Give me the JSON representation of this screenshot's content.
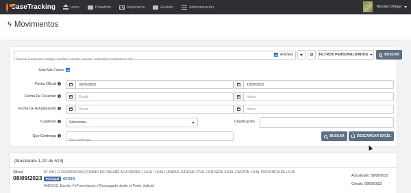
{
  "app": {
    "logo_text": "CaseTracking",
    "nav": [
      {
        "label": "Inicio",
        "icon": "home-icon"
      },
      {
        "label": "Portafolio",
        "icon": "briefcase-icon"
      },
      {
        "label": "Reportería",
        "icon": "chart-icon"
      },
      {
        "label": "Gestión",
        "icon": "folder-icon"
      },
      {
        "label": "Administración",
        "icon": "menu-icon"
      }
    ],
    "user_name": "Nicolas Ortega"
  },
  "page": {
    "title": "Movimientos"
  },
  "search": {
    "placeholder": "Buscar Casos por código, nombre, cliente, asunto, autoridad competente etc...",
    "activada_label": "Activada",
    "filtros_label": "FILTROS PERSONALIZADOS",
    "buscar_label": "BUSCAR"
  },
  "form": {
    "solo_mis_casos_label": "Solo Mis Casos",
    "fecha_oficial_label": "Fecha Oficial",
    "fecha_oficial_from": "30/05/2023",
    "fecha_oficial_to": "10/09/2023",
    "fecha_creacion_label": "Fecha De Creación",
    "fecha_actualizacion_label": "Fecha De Actualización",
    "desde_placeholder": "Desde",
    "hasta_placeholder": "Hasta",
    "cuaderno_label": "Cuaderno",
    "cuaderno_value": "Seleccione...",
    "clasificacion_label": "Clasificación",
    "que_contenga_label": "Que Contenga",
    "que_contenga_placeholder": "Que contenga",
    "buscar_label": "BUSCAR",
    "descargar_label": "DESCARGAR EXCEL"
  },
  "results": {
    "count_text": "(Mostrando 1-20 de 513)",
    "items": [
      {
        "oficial_label": "Oficial:",
        "date": "08/09/2023",
        "main": "N° 205 | 11333202202254 | COBRO DE PAGARÉ A LA ORDEN | LOJA / LOJA / UNIDAD JUDICIAL CIVIL CON SEDE EN EL CANTÓN LOJA, PROVINCIA DE LOJA",
        "badge": "Principal",
        "type": "OFICIO",
        "sub": "ANEXOS, Escrito, FePresentacion / Descargado desde el Poder Judicial",
        "updated": "Actualizado: 08/09/2023",
        "created": "Creado: 08/09/2023"
      }
    ]
  },
  "colors": {
    "navbar": "#2d2f33",
    "accent_orange": "#f3722c",
    "primary_button": "#5d6f80",
    "checkbox_blue": "#1e73e8",
    "badge_blue": "#4a6fa5"
  }
}
